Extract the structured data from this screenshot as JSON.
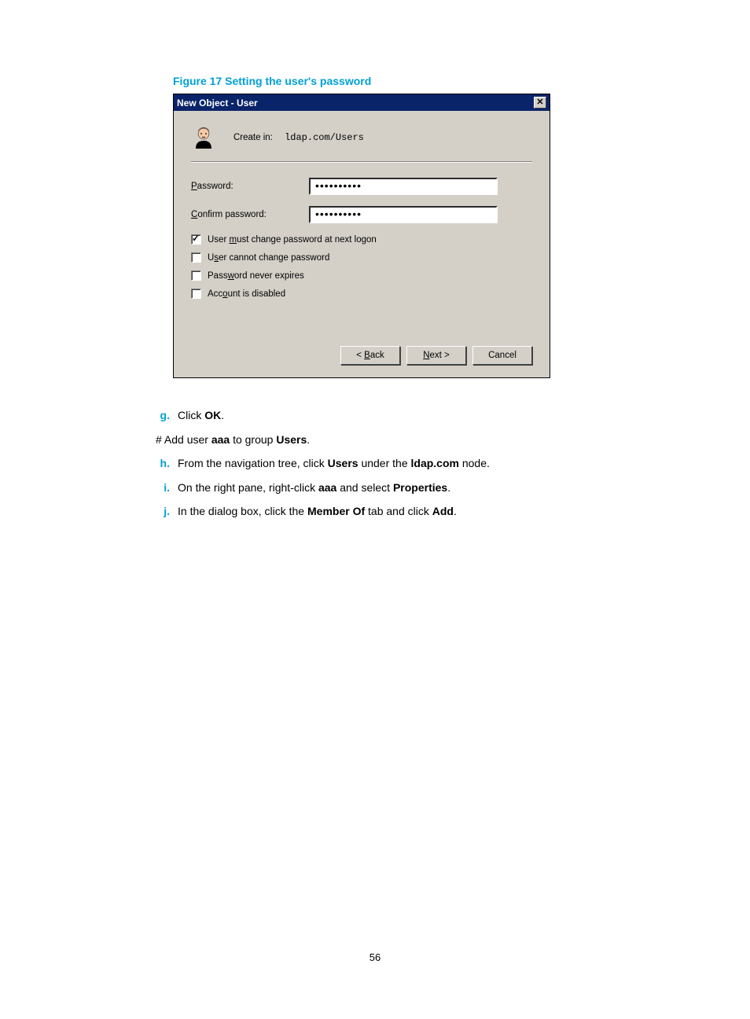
{
  "figure_caption": "Figure 17 Setting the user's password",
  "dialog": {
    "title": "New Object - User",
    "create_in_label": "Create in:",
    "create_in_path": "ldap.com/Users",
    "password_label_pre": "P",
    "password_label_post": "assword:",
    "confirm_label_pre": "C",
    "confirm_label_post": "onfirm password:",
    "password_value": "••••••••••",
    "confirm_value": "••••••••••",
    "checks": [
      {
        "pre": "User ",
        "ul": "m",
        "post": "ust change password at next logon",
        "checked": true
      },
      {
        "pre": "U",
        "ul": "s",
        "post": "er cannot change password",
        "checked": false
      },
      {
        "pre": "Pass",
        "ul": "w",
        "post": "ord never expires",
        "checked": false
      },
      {
        "pre": "Acc",
        "ul": "o",
        "post": "unt is disabled",
        "checked": false
      }
    ],
    "btn_back": "< Back",
    "btn_next": "Next >",
    "btn_cancel": "Cancel"
  },
  "steps": {
    "g": {
      "letter": "g.",
      "text": "Click ",
      "bold": "OK",
      "text2": "."
    },
    "hash": {
      "pre": "# Add user ",
      "b1": "aaa",
      "mid": " to group ",
      "b2": "Users",
      "post": "."
    },
    "h": {
      "letter": "h.",
      "pre": "From the navigation tree, click ",
      "b1": "Users",
      "mid": " under the ",
      "b2": "ldap.com",
      "post": " node."
    },
    "i": {
      "letter": "i.",
      "pre": "On the right pane, right-click ",
      "b1": "aaa",
      "mid": " and select ",
      "b2": "Properties",
      "post": "."
    },
    "j": {
      "letter": "j.",
      "pre": "In the dialog box, click the ",
      "b1": "Member Of",
      "mid": " tab and click ",
      "b2": "Add",
      "post": "."
    }
  },
  "page_number": "56"
}
